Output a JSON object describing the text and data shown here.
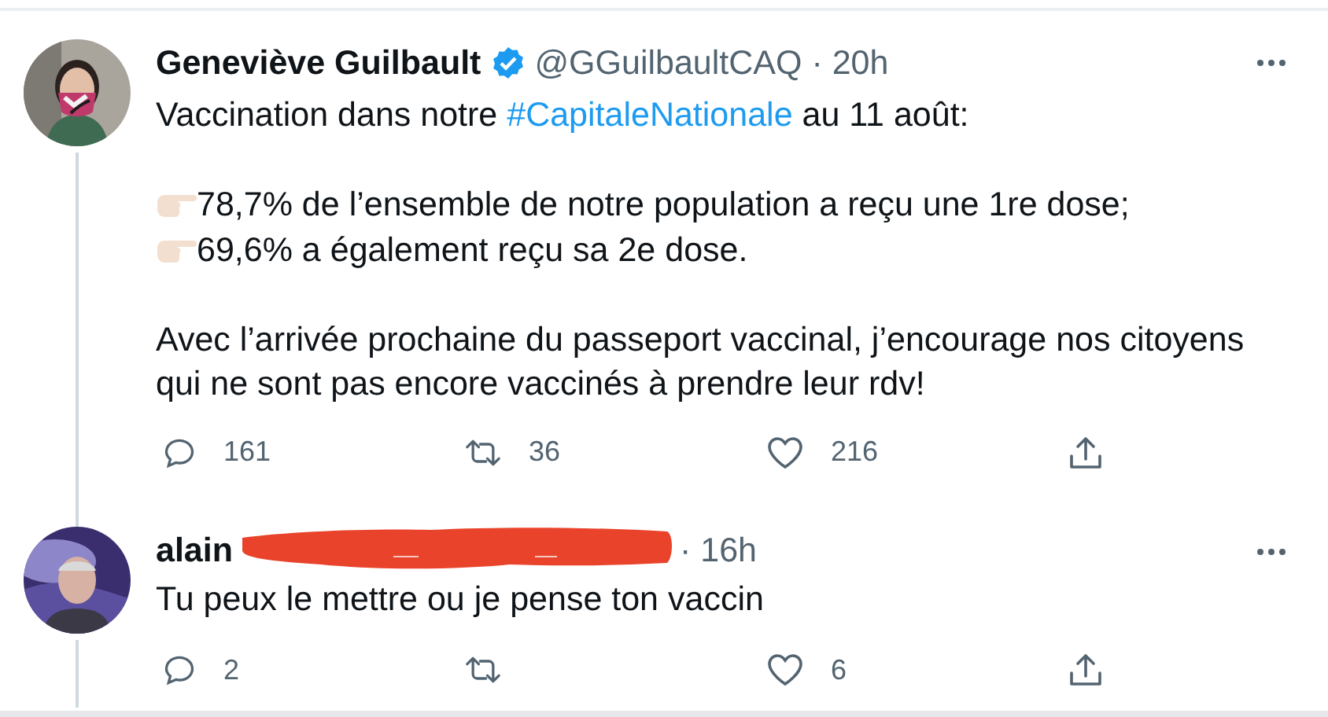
{
  "tweets": [
    {
      "name": "Geneviève Guilbault",
      "verified": true,
      "handle": "@GGuilbaultCAQ",
      "time": "· 20h",
      "redacted": false,
      "thread_line_above": false,
      "body": [
        {
          "kind": "text",
          "parts": [
            {
              "kind": "plain",
              "text": "Vaccination dans notre "
            },
            {
              "kind": "hashtag",
              "text": "#CapitaleNationale"
            },
            {
              "kind": "plain",
              "text": " au 11 août:"
            }
          ]
        },
        {
          "kind": "gap"
        },
        {
          "kind": "pointer",
          "text": "78,7% de l’ensemble de notre population a reçu une 1re dose;"
        },
        {
          "kind": "pointer",
          "text": "69,6% a également reçu sa 2e dose."
        },
        {
          "kind": "gap"
        },
        {
          "kind": "text",
          "parts": [
            {
              "kind": "plain",
              "text": "Avec l’arrivée prochaine du passeport vaccinal, j’encourage nos citoyens qui ne sont pas encore vaccinés à prendre leur rdv!"
            }
          ]
        }
      ],
      "actions": [
        {
          "kind": "reply",
          "count": "161"
        },
        {
          "kind": "retweet",
          "count": "36"
        },
        {
          "kind": "like",
          "count": "216"
        },
        {
          "kind": "share"
        }
      ]
    },
    {
      "name": "alain",
      "verified": false,
      "time": "· 16h",
      "redacted": true,
      "thread_line_above": true,
      "body": [
        {
          "kind": "text",
          "parts": [
            {
              "kind": "plain",
              "text": "Tu peux le mettre ou je pense ton vaccin"
            }
          ]
        }
      ],
      "actions": [
        {
          "kind": "reply",
          "count": "2"
        },
        {
          "kind": "retweet"
        },
        {
          "kind": "like",
          "count": "6"
        },
        {
          "kind": "share"
        }
      ]
    }
  ]
}
